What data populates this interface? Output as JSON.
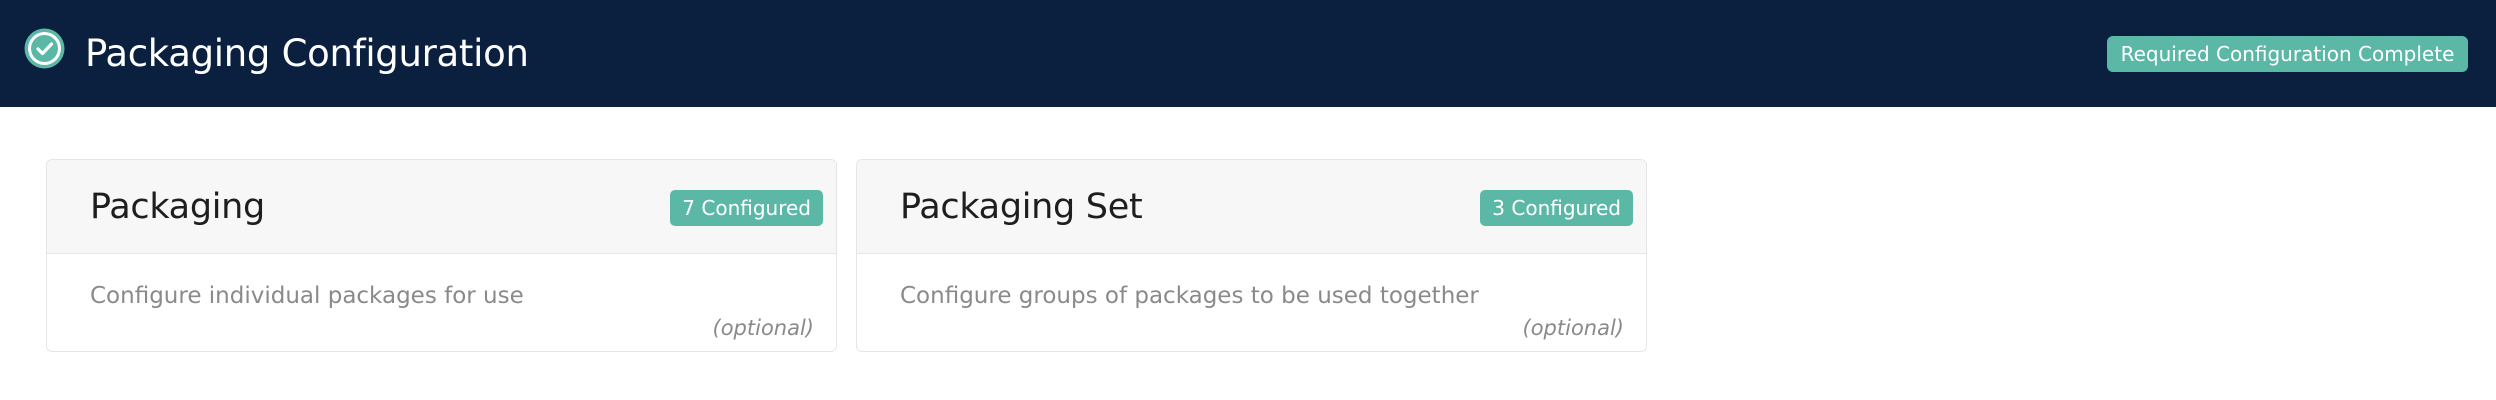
{
  "header": {
    "title": "Packaging Configuration",
    "status_badge": "Required Configuration Complete",
    "icon": "check-circle-icon",
    "background_color": "#0b1f3f",
    "accent_color": "#5cb8a6"
  },
  "cards": [
    {
      "title": "Packaging",
      "badge": "7 Configured",
      "description": "Configure individual packages for use",
      "optional_label": "(optional)"
    },
    {
      "title": "Packaging Set",
      "badge": "3 Configured",
      "description": "Configure groups of packages to be used together",
      "optional_label": "(optional)"
    }
  ]
}
